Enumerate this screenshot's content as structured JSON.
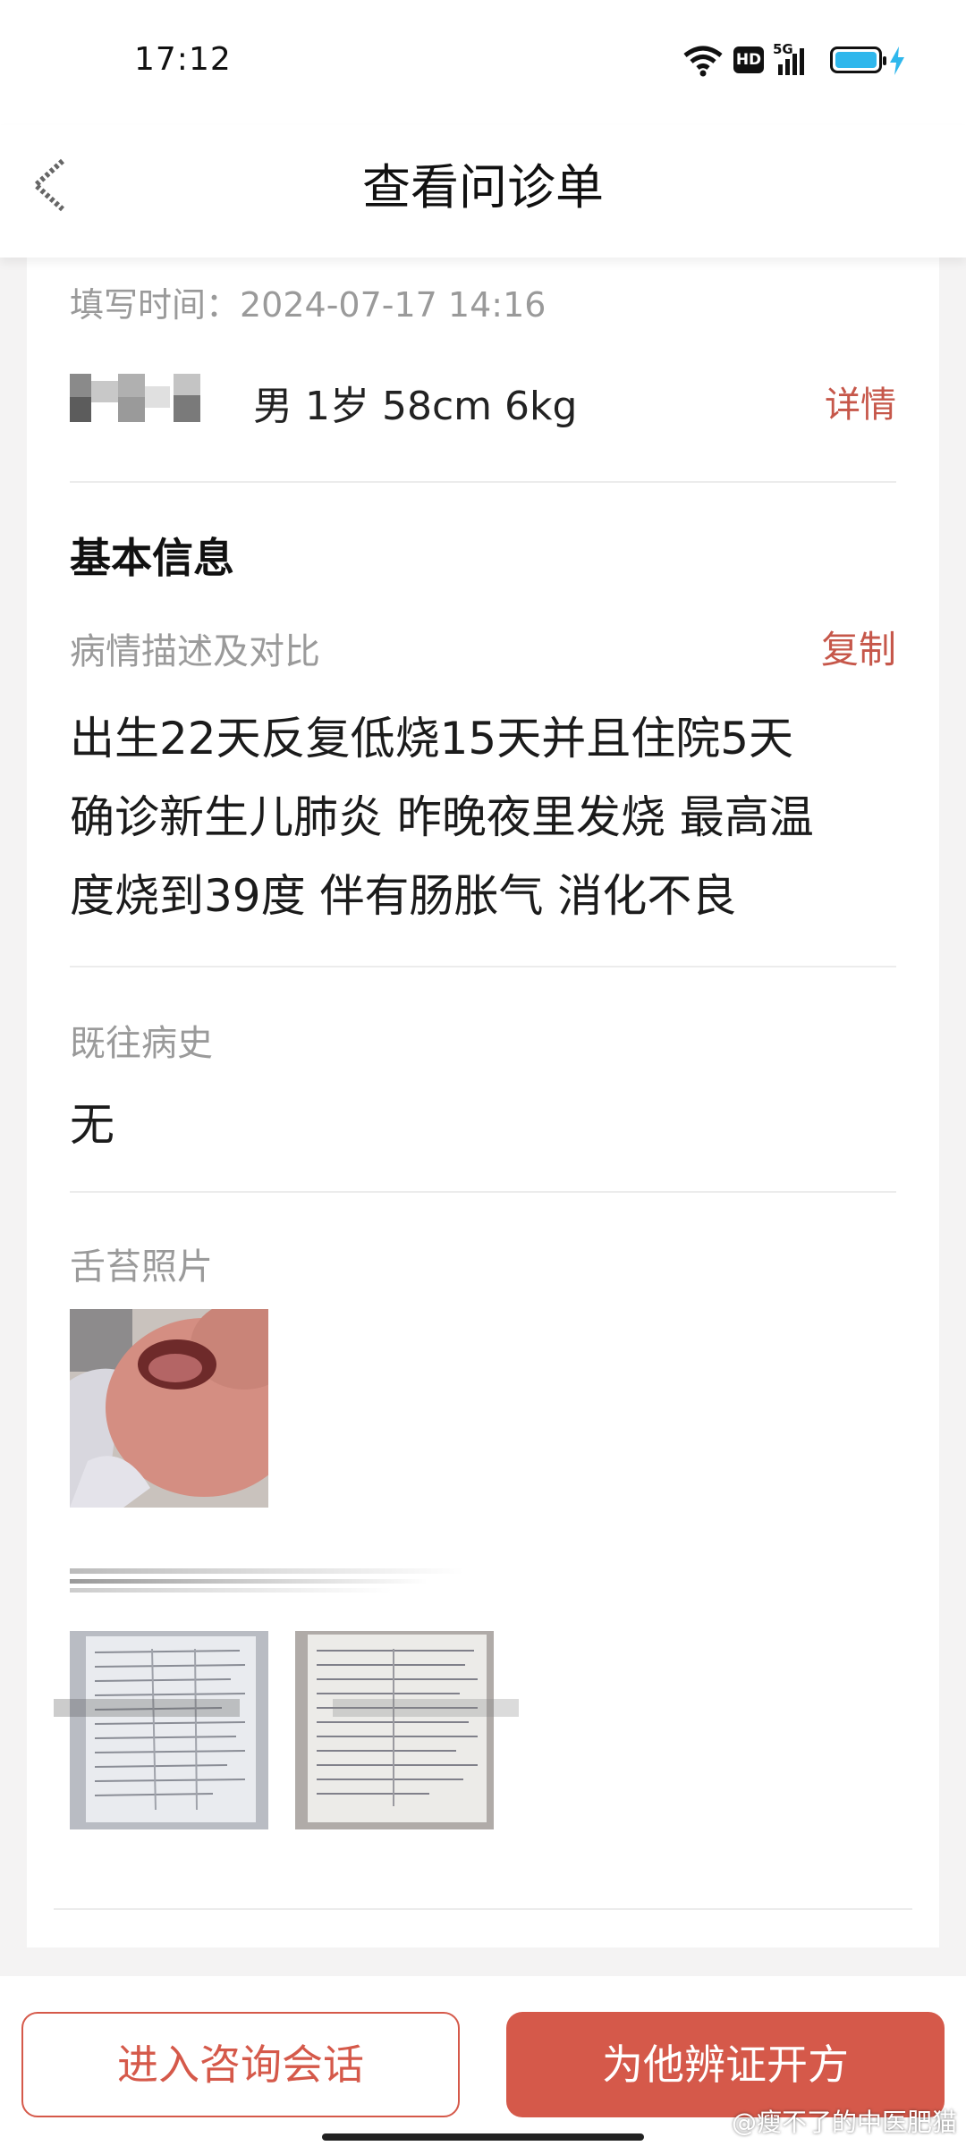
{
  "status_bar": {
    "time": "17:12",
    "icons": [
      "wifi-icon",
      "hd-icon",
      "5g-signal-icon",
      "battery-icon",
      "charging-icon"
    ],
    "hd_label": "HD",
    "net_label": "5G"
  },
  "header": {
    "title": "查看问诊单",
    "back_icon": "back-arrow-icon"
  },
  "form": {
    "fill_time": "填写时间：2024-07-17 14:16",
    "patient_info": "男 1岁 58cm 6kg",
    "detail_label": "详情",
    "basic_info_title": "基本信息",
    "condition_label": "病情描述及对比",
    "copy_label": "复制",
    "condition_lines": [
      "出生22天反复低烧15天并且住院5天",
      "确诊新生儿肺炎 昨晚夜里发烧 最高温",
      "度烧到39度 伴有肠胀气 消化不良"
    ],
    "history_label": "既往病史",
    "history_value": "无",
    "tongue_label": "舌苔照片"
  },
  "bottom_bar": {
    "consult_label": "进入咨询会话",
    "prescribe_label": "为他辨证开方"
  },
  "watermark": "@瘦不了的中医肥猫",
  "colors": {
    "accent": "#d5594a",
    "link": "#c6574a",
    "muted": "#9a9a9a",
    "background": "#f4f3f3"
  }
}
